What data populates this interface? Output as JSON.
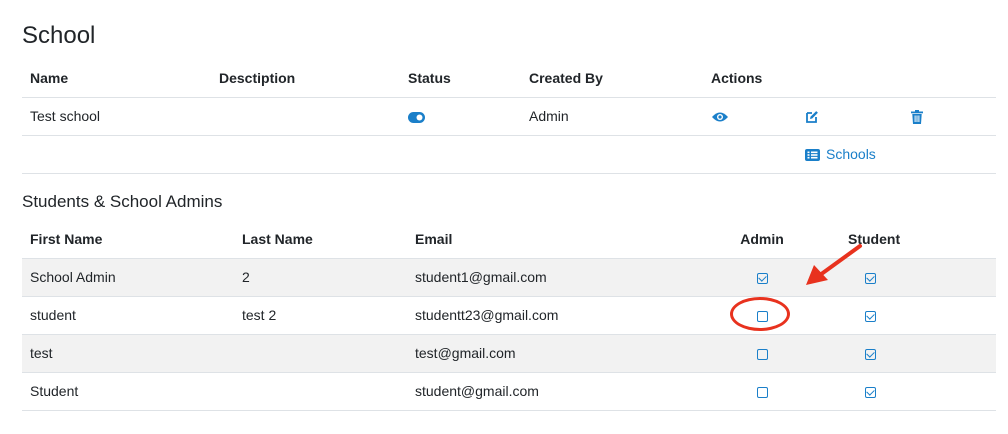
{
  "school_section": {
    "title": "School",
    "columns": [
      "Name",
      "Desctiption",
      "Status",
      "Created By",
      "Actions"
    ],
    "rows": [
      {
        "name": "Test school",
        "description": "",
        "status": "active",
        "created_by": "Admin"
      }
    ],
    "schools_link": "Schools"
  },
  "students_section": {
    "title": "Students & School Admins",
    "columns": [
      "First Name",
      "Last Name",
      "Email",
      "Admin",
      "Student"
    ],
    "rows": [
      {
        "first_name": "School Admin",
        "last_name": "2",
        "email": "student1@gmail.com",
        "admin": true,
        "student": true
      },
      {
        "first_name": "student",
        "last_name": "test 2",
        "email": "studentt23@gmail.com",
        "admin": false,
        "student": true
      },
      {
        "first_name": "test",
        "last_name": "",
        "email": "test@gmail.com",
        "admin": false,
        "student": true
      },
      {
        "first_name": "Student",
        "last_name": "",
        "email": "student@gmail.com",
        "admin": false,
        "student": true
      }
    ]
  },
  "colors": {
    "accent": "#1a7fc9",
    "annotation": "#e8321e",
    "stripe": "#f2f2f2"
  },
  "icons": [
    "toggle-on-icon",
    "eye-icon",
    "edit-icon",
    "trash-icon",
    "list-icon"
  ]
}
